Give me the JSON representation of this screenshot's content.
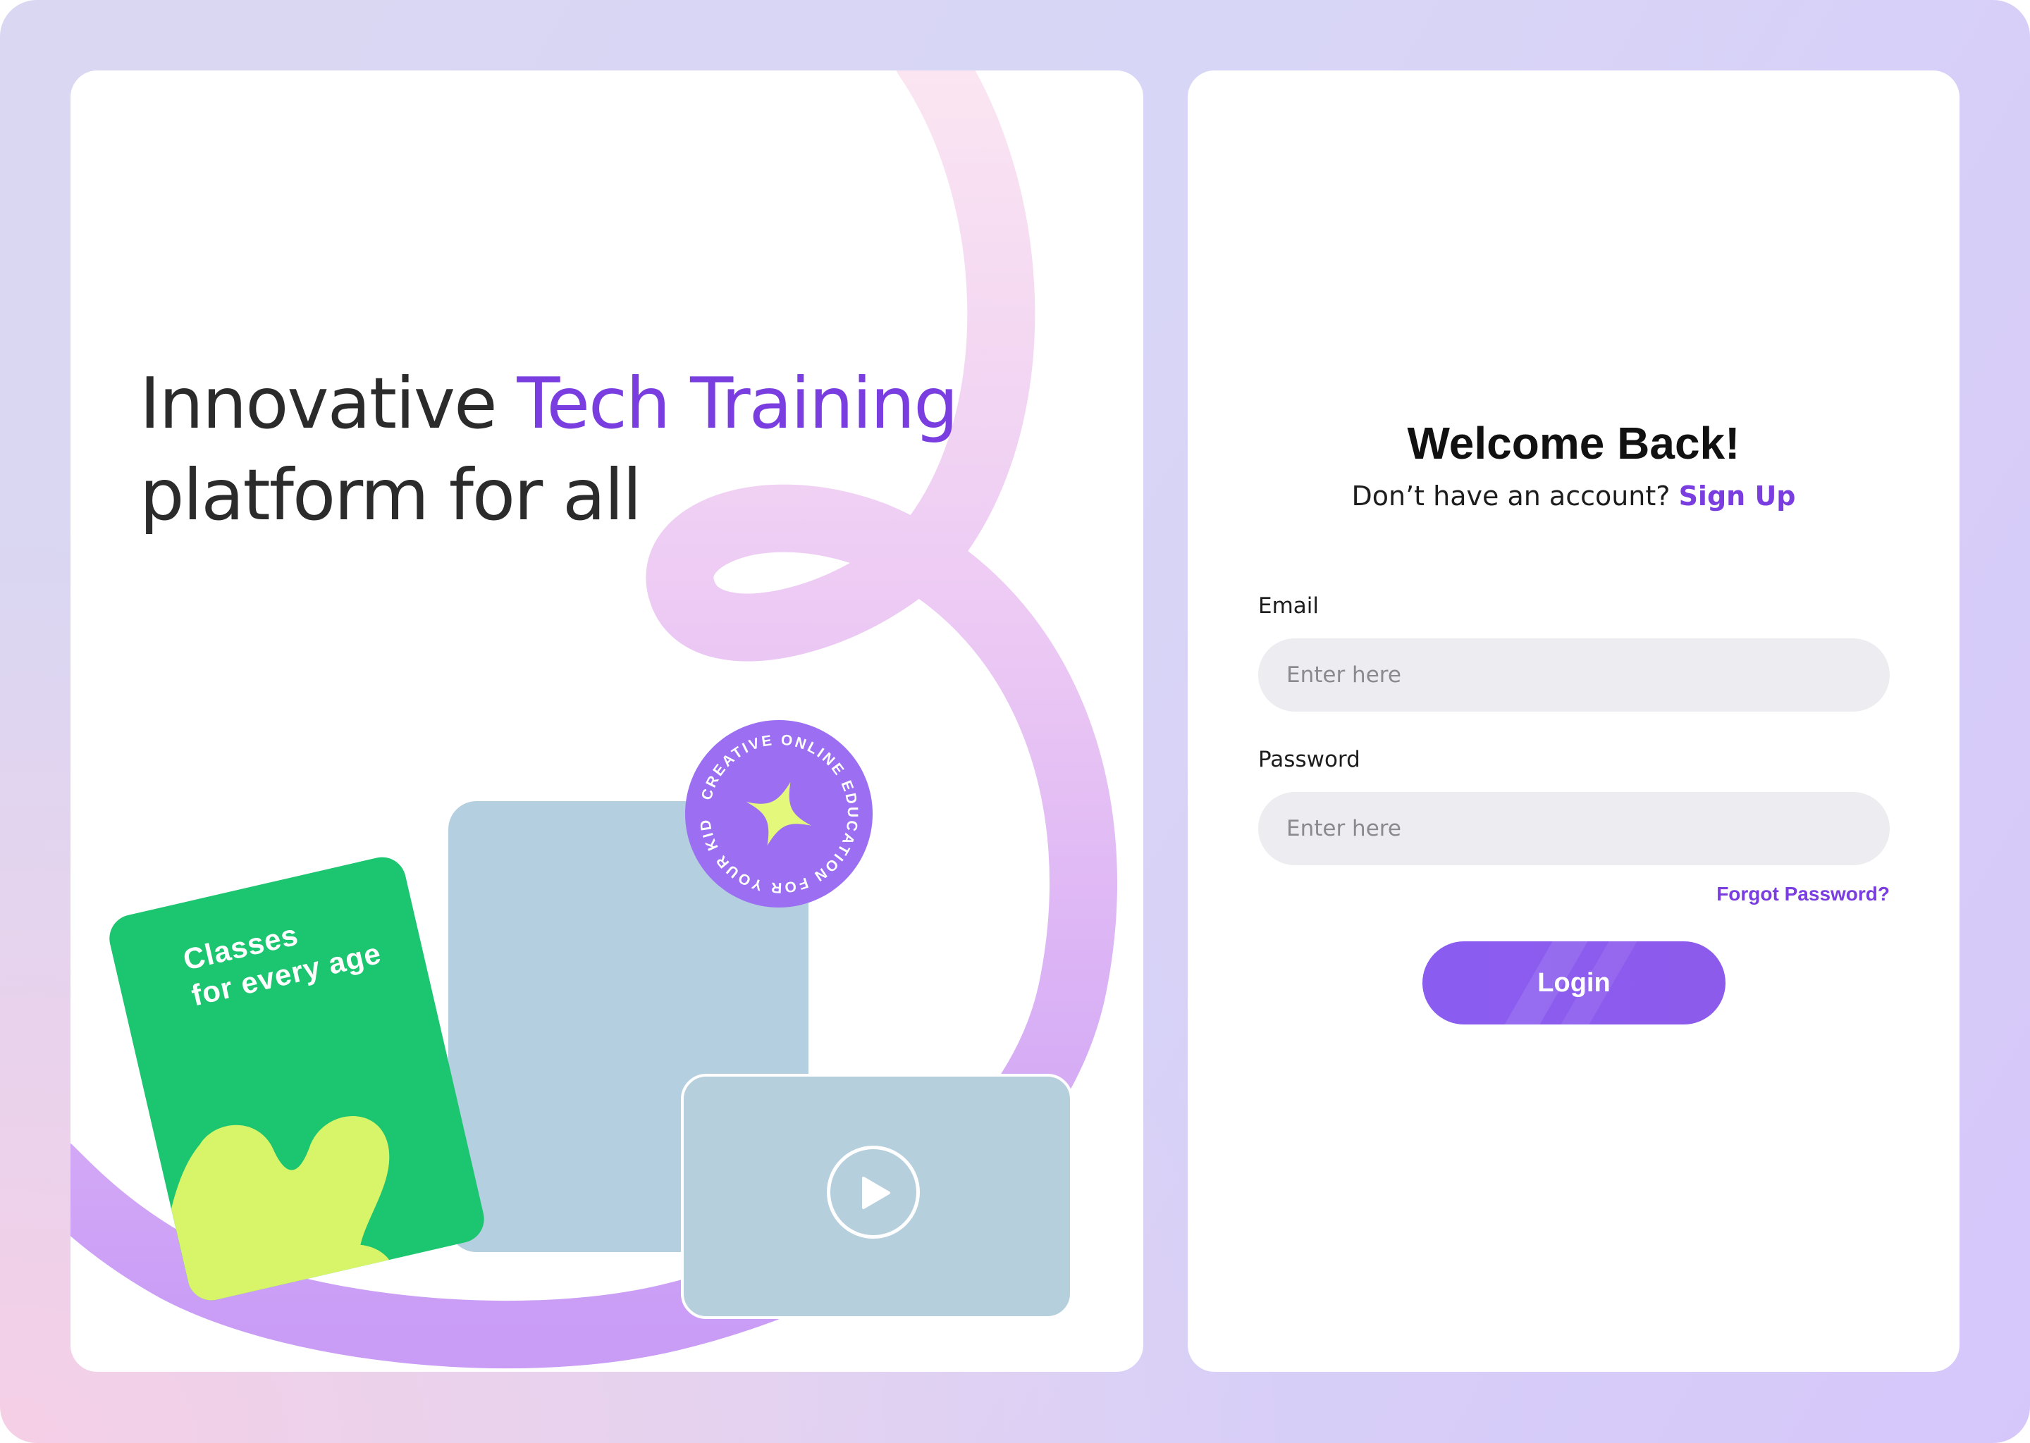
{
  "hero": {
    "title_prefix": "Innovative ",
    "title_accent": "Tech Training",
    "title_line2": "platform for all"
  },
  "promo_card": {
    "line1": "Classes",
    "line2": "for every age"
  },
  "badge": {
    "circular_text": "CREATIVE ONLINE EDUCATION FOR YOUR KIDS"
  },
  "login": {
    "heading": "Welcome Back!",
    "no_account_text": "Don’t have an account?",
    "signup_link": "Sign Up",
    "email_label": "Email",
    "email_placeholder": "Enter here",
    "email_value": "",
    "password_label": "Password",
    "password_placeholder": "Enter here",
    "password_value": "",
    "forgot_link": "Forgot Password?",
    "login_button": "Login"
  },
  "colors": {
    "accent_purple": "#7a3de0",
    "ribbon_pink": "#f9dff0",
    "ribbon_violet": "#cfa0f7",
    "promo_green": "#1cc56f",
    "blob_lime": "#d8f56a",
    "tablet_blue": "#b3cfe0",
    "badge_purple": "#9b6ef2"
  },
  "icons": [
    "play-icon",
    "sparkle-icon",
    "blob-shape"
  ]
}
